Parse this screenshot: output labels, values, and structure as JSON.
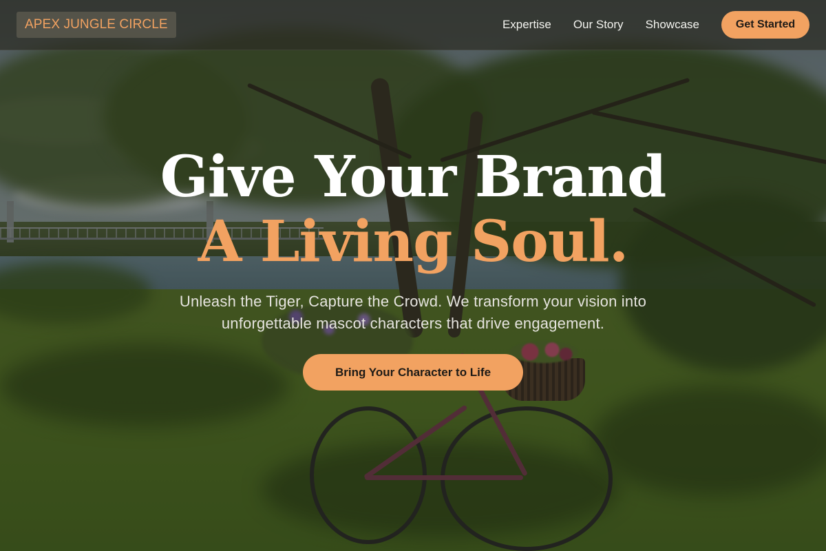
{
  "nav": {
    "logo": "APEX JUNGLE CIRCLE",
    "links": [
      {
        "label": "Expertise"
      },
      {
        "label": "Our Story"
      },
      {
        "label": "Showcase"
      }
    ],
    "cta_label": "Get Started"
  },
  "hero": {
    "headline_line1": "Give Your Brand",
    "headline_line2": "A Living Soul.",
    "subtitle": "Unleash the Tiger, Capture the Crowd. We transform your vision into unforgettable mascot characters that drive engagement.",
    "cta_label": "Bring Your Character to Life"
  },
  "colors": {
    "accent": "#f2a261",
    "nav_background": "#2c2c24",
    "headline_primary": "#ffffff",
    "text_muted": "#e6e4df"
  }
}
